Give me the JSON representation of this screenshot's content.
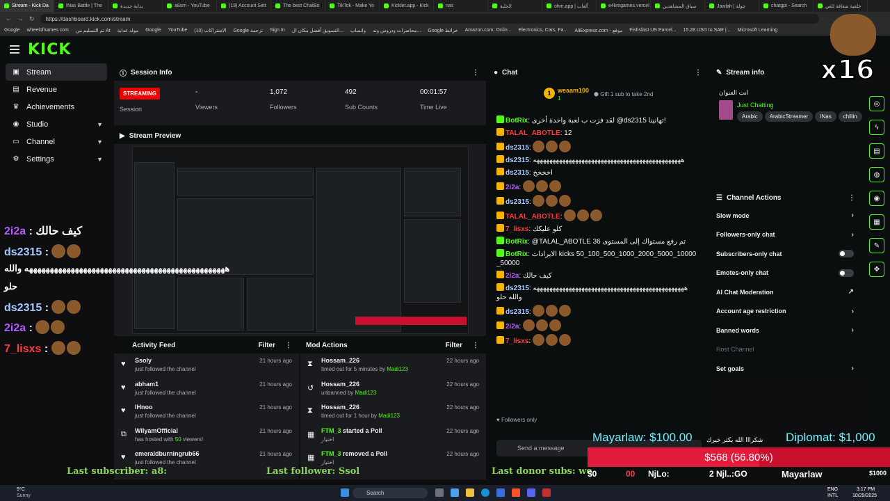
{
  "browser": {
    "tabs": [
      "Stream - Kick Da",
      "INas Battle | The",
      "بداية جديدة",
      "a8sm - YouTube",
      "(19) Account Sett",
      "The best ChatBo",
      "TikTok - Make Yo",
      "Kicklet.app - Kick",
      "nas",
      "الحلبة",
      "ohm.app | ألعاب",
      "e4kmgames.vercel",
      "سباق المشاهدين",
      "Jawlah | جولة",
      "chatgpt - Search",
      "خلفية شفافة للص"
    ],
    "url": "https://dashboard.kick.com/stream",
    "bookmarks": [
      "Google",
      "wheelofnames.com",
      "تم التسليم من At",
      "مولد عداية",
      "Google",
      "YouTube",
      "(10) الاشتراكات",
      "Google ترجمة",
      "Sign In",
      "التسويق أفضل مكان ال...",
      "واتساب",
      "محاضرات ودروس وند...",
      "Google خرائط",
      "Amazon.com: Onlin...",
      "Electronics, Cars, Fa...",
      "AliExpress.com - موقع",
      "Fishsfast US Parcel...",
      "15.28 USD to SAR |...",
      "Microsoft Learning"
    ]
  },
  "header": {
    "logo": "KICK"
  },
  "sidebar": {
    "items": [
      {
        "label": "Stream",
        "icon": "broadcast-icon"
      },
      {
        "label": "Revenue",
        "icon": "wallet-icon"
      },
      {
        "label": "Achievements",
        "icon": "trophy-icon"
      },
      {
        "label": "Studio",
        "icon": "studio-icon"
      },
      {
        "label": "Channel",
        "icon": "channel-icon"
      },
      {
        "label": "Settings",
        "icon": "gear-icon"
      }
    ]
  },
  "session": {
    "title": "Session Info",
    "status": "STREAMING",
    "session_label": "Session",
    "stats": [
      {
        "value": "-",
        "label": "Viewers"
      },
      {
        "value": "1,072",
        "label": "Followers"
      },
      {
        "value": "492",
        "label": "Sub Counts"
      },
      {
        "value": "00:01:57",
        "label": "Time Live"
      }
    ]
  },
  "preview": {
    "title": "Stream Preview"
  },
  "activity": {
    "title": "Activity Feed",
    "filter": "Filter",
    "rows": [
      {
        "name": "Ssoly",
        "sub": "just followed the channel",
        "time": "21 hours ago",
        "icon": "heart-icon"
      },
      {
        "name": "abham1",
        "sub": "just followed the channel",
        "time": "21 hours ago",
        "icon": "heart-icon"
      },
      {
        "name": "IHnoo",
        "sub": "just followed the channel",
        "time": "21 hours ago",
        "icon": "heart-icon"
      },
      {
        "name": "WilyamOfficial",
        "sub_pre": "has hosted with ",
        "sub_hl": "50",
        "sub_post": " viewers!",
        "time": "21 hours ago",
        "icon": "host-icon"
      },
      {
        "name": "emeraldburningrub66",
        "sub": "just followed the channel",
        "time": "21 hours ago",
        "icon": "heart-icon"
      }
    ]
  },
  "mod": {
    "title": "Mod Actions",
    "filter": "Filter",
    "rows": [
      {
        "name": "Hossam_226",
        "sub_pre": "timed out for 5 minutes by ",
        "by": "Madi123",
        "time": "22 hours ago",
        "icon": "hourglass-icon"
      },
      {
        "name": "Hossam_226",
        "sub_pre": "unbanned by ",
        "by": "Madi123",
        "time": "22 hours ago",
        "icon": "undo-icon"
      },
      {
        "name": "Hossam_226",
        "sub_pre": "timed out for 1 hour by ",
        "by": "Madi123",
        "time": "22 hours ago",
        "icon": "hourglass-icon"
      },
      {
        "name": "FTM_3",
        "action": " started a Poll",
        "sub_pre": "اختيار",
        "by": "",
        "time": "22 hours ago",
        "icon": "poll-icon"
      },
      {
        "name": "FTM_3",
        "action": " removed a Poll",
        "sub_pre": "اختيار",
        "by": "",
        "time": "22 hours ago",
        "icon": "poll-icon"
      }
    ]
  },
  "chat": {
    "title": "Chat",
    "pinned_user": "weaam100",
    "pinned_count": "1",
    "gift_text": "Gift 1 sub to take 2nd",
    "lines": [
      {
        "user": "BotRix",
        "color": "#53fc18",
        "text": "لقد فزت ب لعبة واحدة أخرى @ds2315 تهانينا!"
      },
      {
        "user": "TALAL_ABOTLE",
        "color": "#ff3b3b",
        "text": "12"
      },
      {
        "user": "ds2315",
        "color": "#a8c8ff",
        "text": ""
      },
      {
        "user": "ds2315",
        "color": "#a8c8ff",
        "text": "ههههههههههههههههههههههههههههههههههههههههههههههه"
      },
      {
        "user": "ds2315",
        "color": "#a8c8ff",
        "text": "اخخخخ"
      },
      {
        "user": "2i2a",
        "color": "#b45cff",
        "text": ""
      },
      {
        "user": "ds2315",
        "color": "#a8c8ff",
        "text": ""
      },
      {
        "user": "TALAL_ABOTLE",
        "color": "#ff3b3b",
        "text": ""
      },
      {
        "user": "7_lisxs",
        "color": "#ff3b3b",
        "text": "كلو عليكك"
      },
      {
        "user": "BotRix",
        "color": "#53fc18",
        "text": "@TALAL_ABOTLE تم رفع مستواك إلى المستوى 36"
      },
      {
        "user": "BotRix",
        "color": "#53fc18",
        "text": "الايرادات kicks 50_100_500_1000_2000_5000_10000 _50000"
      },
      {
        "user": "2i2a",
        "color": "#b45cff",
        "text": "كيف حالك"
      },
      {
        "user": "ds2315",
        "color": "#a8c8ff",
        "text": "هههههههههههههههههههههههههههههههههههههههههههههههه والله حلو"
      },
      {
        "user": "ds2315",
        "color": "#a8c8ff",
        "text": ""
      },
      {
        "user": "2i2a",
        "color": "#b45cff",
        "text": ""
      },
      {
        "user": "7_lisxs",
        "color": "#ff3b3b",
        "text": ""
      }
    ],
    "followers_only": "Followers only",
    "input_placeholder": "Send a message"
  },
  "stream_info": {
    "title": "Stream info",
    "stream_title": "انت العنوان",
    "category": "Just Chatting",
    "tags": [
      "Arabic",
      "ArabicStreamer",
      "INas",
      "chillin"
    ]
  },
  "channel_actions": {
    "title": "Channel Actions",
    "rows": [
      {
        "label": "Slow mode",
        "type": "arrow"
      },
      {
        "label": "Followers-only chat",
        "type": "arrow"
      },
      {
        "label": "Subscribers-only chat",
        "type": "toggle"
      },
      {
        "label": "Emotes-only chat",
        "type": "toggle"
      },
      {
        "label": "AI Chat Moderation",
        "type": "external"
      },
      {
        "label": "Account age restriction",
        "type": "arrow"
      },
      {
        "label": "Banned words",
        "type": "arrow"
      },
      {
        "label": "Host Channel",
        "type": "disabled"
      },
      {
        "label": "Set goals",
        "type": "arrow"
      }
    ]
  },
  "overlay": {
    "multiplier": "x16",
    "left_chat": [
      {
        "user": "2i2a",
        "text": "كيف حالك"
      },
      {
        "user": "ds2315",
        "text": ""
      },
      {
        "user": "",
        "text": "ههههههههههههههههههههههههههههههههههههههههههههههههه والله"
      },
      {
        "user": "",
        "text": "حلو"
      },
      {
        "user": "ds2315",
        "text": ""
      },
      {
        "user": "2i2a",
        "text": ""
      },
      {
        "user": "7_lisxs",
        "text": ""
      }
    ],
    "last_subscriber": "Last subscriber: a8:",
    "last_follower": "Last follower: Ssol",
    "last_donor": "Last donor subs: we",
    "donor_left": "Mayarlaw: $100.00",
    "donor_right": "Diplomat: $1,000",
    "thanks_text": "شكرااا الله يكثر خيرك",
    "goal_text": "$568 (56.80%)",
    "goal_fraction": 0.568,
    "goal_start": "$0",
    "goal_end": "$1000",
    "ticker": [
      "00",
      "NjLo:",
      "2 Njl..:GO",
      "Mayarlaw"
    ]
  },
  "taskbar": {
    "weather_temp": "9°C",
    "weather_desc": "Sunny",
    "search": "Search",
    "lang": "ENG",
    "lang2": "INTL",
    "time": "3:17 PM",
    "date": "10/29/2025"
  }
}
